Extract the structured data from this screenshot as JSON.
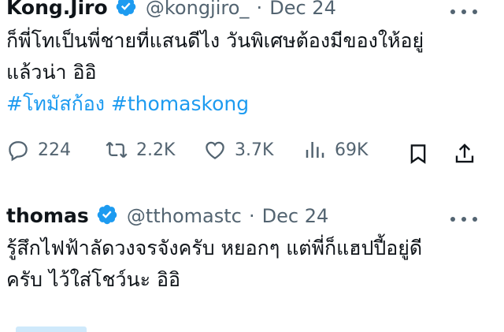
{
  "tweets": [
    {
      "name": "Kong.Jiro",
      "handle": "@kongjiro_",
      "separator": "·",
      "date": "Dec 24",
      "text_line1": "ก็พี่โทเป็นพี่ชายที่แสนดีไง วันพิเศษต้องมีของให้อยู่",
      "text_line2": "แล้วน่า อิอิ",
      "hashtags": [
        "#โทมัสก้อง",
        "#thomaskong"
      ],
      "replies": "224",
      "retweets": "2.2K",
      "likes": "3.7K",
      "views": "69K"
    },
    {
      "name": "thomas",
      "handle": "@tthomastc",
      "separator": "·",
      "date": "Dec 24",
      "text_line1": "รู้สึกไฟฟ้าลัดวงจรจังครับ หยอกๆ แต่พี่ก็แฮปปี้อยู่ดี",
      "text_line2": "ครับ ไว้ใส่โชว์นะ อิอิ"
    }
  ],
  "colors": {
    "verified": "#1d9bf0",
    "hashtag": "#1d9bf0",
    "muted": "#536471"
  },
  "icons": [
    "verified-badge-icon",
    "more-icon",
    "reply-icon",
    "retweet-icon",
    "like-icon",
    "views-icon",
    "bookmark-icon",
    "share-icon"
  ]
}
